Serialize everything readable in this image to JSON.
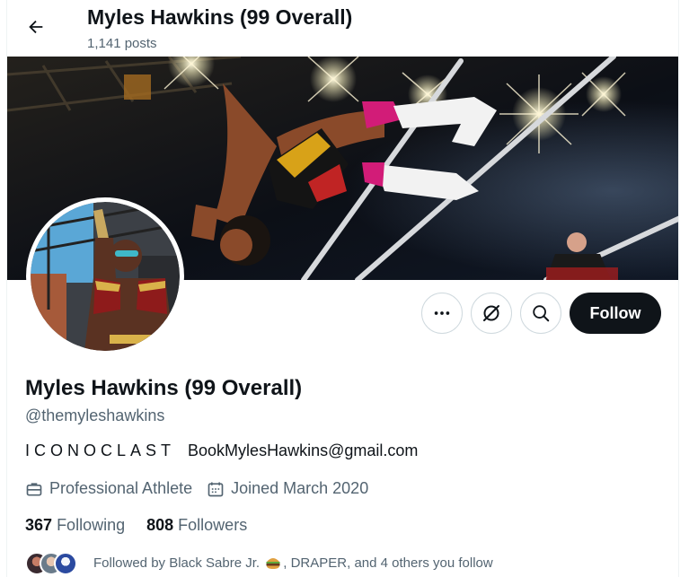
{
  "header": {
    "title": "Myles Hawkins (99 Overall)",
    "posts": "1,141 posts"
  },
  "actions": {
    "follow_label": "Follow"
  },
  "profile": {
    "display_name": "Myles Hawkins (99 Overall)",
    "handle": "@themyleshawkins",
    "bio_word": "ICONOCLAST",
    "bio_email": "BookMylesHawkins@gmail.com",
    "profession": "Professional Athlete",
    "joined": "Joined March 2020"
  },
  "stats": {
    "following_count": "367",
    "following_label": "Following",
    "followers_count": "808",
    "followers_label": "Followers"
  },
  "followed_by": {
    "prefix": "Followed by Black Sabre Jr.",
    "suffix": ", DRAPER, and 4 others you follow"
  },
  "colors": {
    "text_primary": "#0f1419",
    "text_secondary": "#536471",
    "border": "#cfd9de",
    "follow_bg": "#0f1419"
  },
  "icons": [
    "back-arrow-icon",
    "more-icon",
    "subscribe-icon",
    "search-icon",
    "briefcase-icon",
    "calendar-icon",
    "burger-emoji-icon"
  ]
}
